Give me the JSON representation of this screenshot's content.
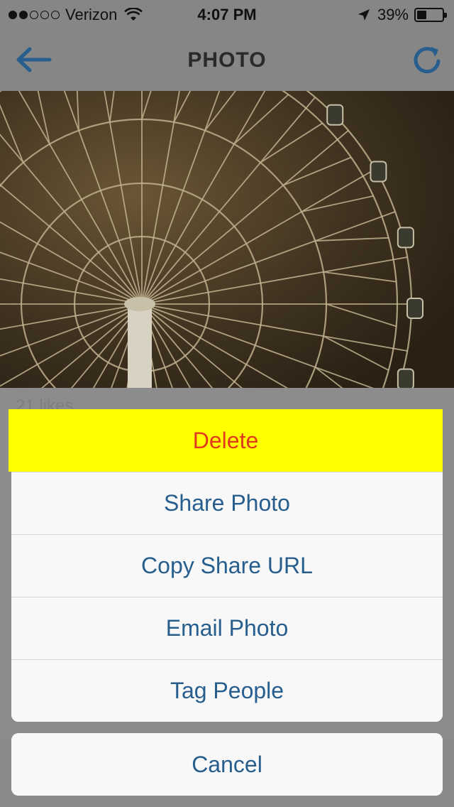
{
  "status_bar": {
    "carrier": "Verizon",
    "time": "4:07 PM",
    "battery_percent": "39%",
    "battery_level": 0.39,
    "signal_bars_filled": 2,
    "signal_bars_total": 5,
    "icons": [
      "wifi-icon",
      "location-arrow-icon",
      "battery-icon"
    ]
  },
  "nav": {
    "title": "PHOTO",
    "back_icon": "arrow-left-icon",
    "refresh_icon": "refresh-icon",
    "accent_color": "#275e8d"
  },
  "post": {
    "likes": "21 likes"
  },
  "action_sheet": {
    "items": [
      {
        "label": "Delete",
        "destructive": true,
        "highlighted": true
      },
      {
        "label": "Share Photo"
      },
      {
        "label": "Copy Share URL"
      },
      {
        "label": "Email Photo"
      },
      {
        "label": "Tag People"
      }
    ],
    "cancel_label": "Cancel",
    "colors": {
      "text": "#275e8d",
      "destructive": "#e03a1a",
      "highlight": "#ffff00"
    }
  }
}
